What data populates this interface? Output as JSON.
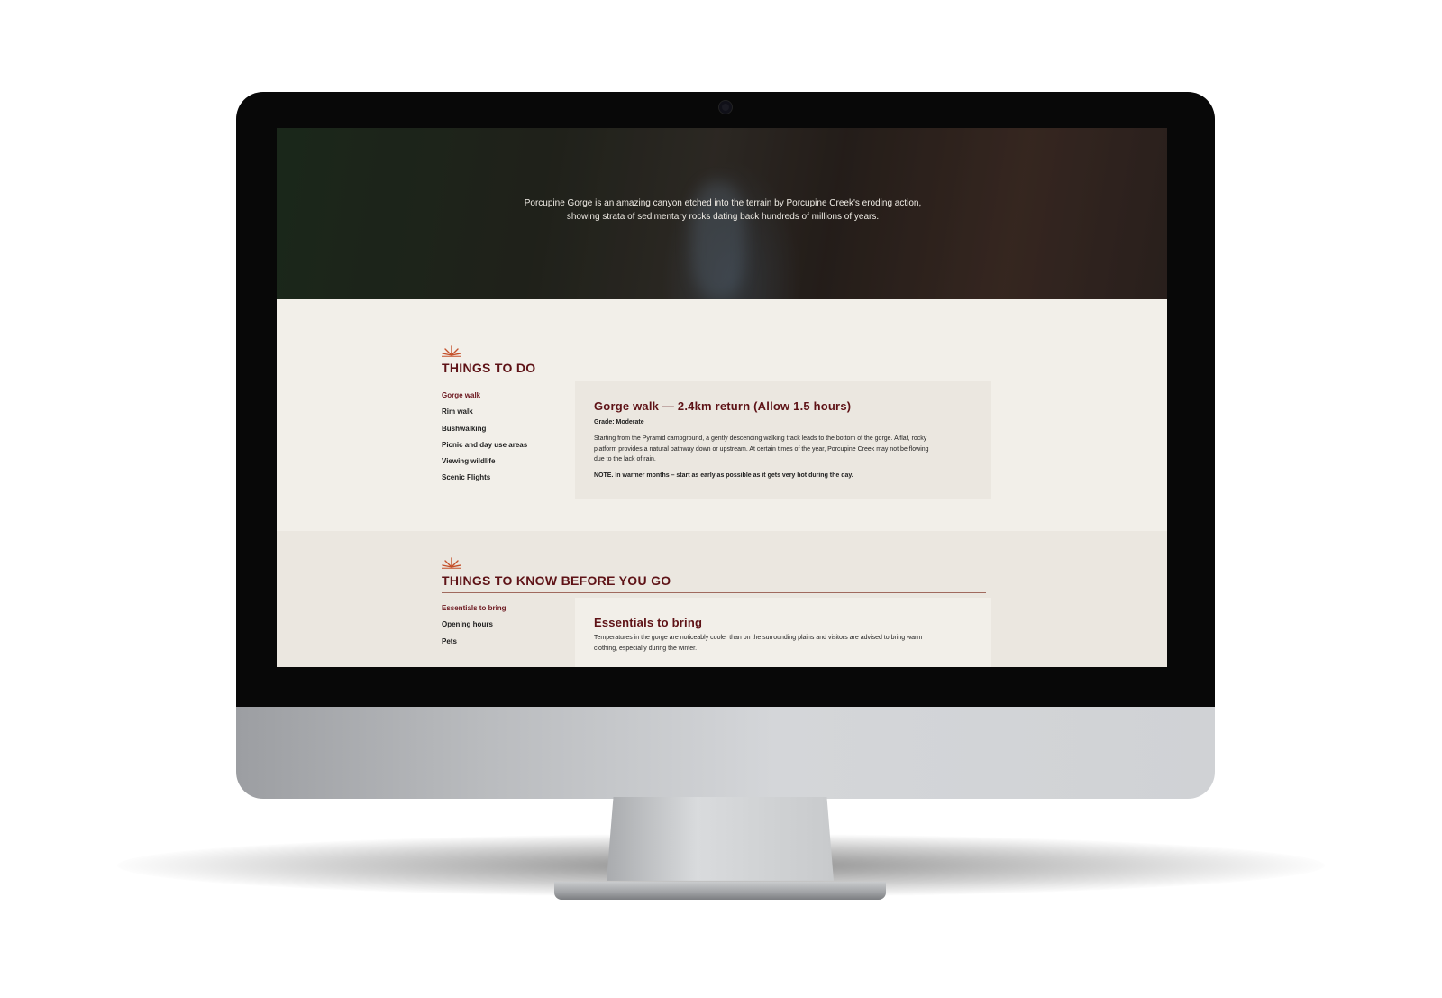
{
  "hero": {
    "caption_line1": "Porcupine Gorge is an amazing canyon etched into the terrain by Porcupine Creek's eroding action,",
    "caption_line2": "showing strata of sedimentary rocks dating back hundreds of millions of years."
  },
  "things_to_do": {
    "title": "THINGS TO DO",
    "nav": [
      {
        "label": "Gorge walk",
        "active": true
      },
      {
        "label": "Rim walk"
      },
      {
        "label": "Bushwalking"
      },
      {
        "label": "Picnic and day use areas"
      },
      {
        "label": "Viewing wildlife"
      },
      {
        "label": "Scenic Flights"
      }
    ],
    "panel": {
      "heading": "Gorge walk — 2.4km return (Allow 1.5 hours)",
      "grade": "Grade: Moderate",
      "body_line1": "Starting from the Pyramid campground, a gently descending walking track leads to the bottom of the  gorge. A flat, rocky",
      "body_line2": "platform provides a natural pathway down or upstream. At certain times of the  year, Porcupine Creek may not be flowing",
      "body_line3": "due to the lack of rain.",
      "note": "NOTE. In warmer months – start as early as possible as it gets very hot during the day."
    }
  },
  "things_to_know": {
    "title": "THINGS TO KNOW BEFORE YOU GO",
    "nav": [
      {
        "label": "Essentials to bring",
        "active": true
      },
      {
        "label": "Opening hours"
      },
      {
        "label": "Pets"
      }
    ],
    "panel": {
      "heading": "Essentials to bring",
      "body_line1": "Temperatures in the gorge are noticeably cooler than on the surrounding plains and visitors are advised to  bring warm",
      "body_line2": "clothing, especially during the winter."
    }
  },
  "colors": {
    "accent": "#5e1216",
    "burst": "#c4502a",
    "section_light": "#f2efe9",
    "section_alt": "#ebe7e0"
  },
  "icons": [
    "sunburst-icon"
  ]
}
